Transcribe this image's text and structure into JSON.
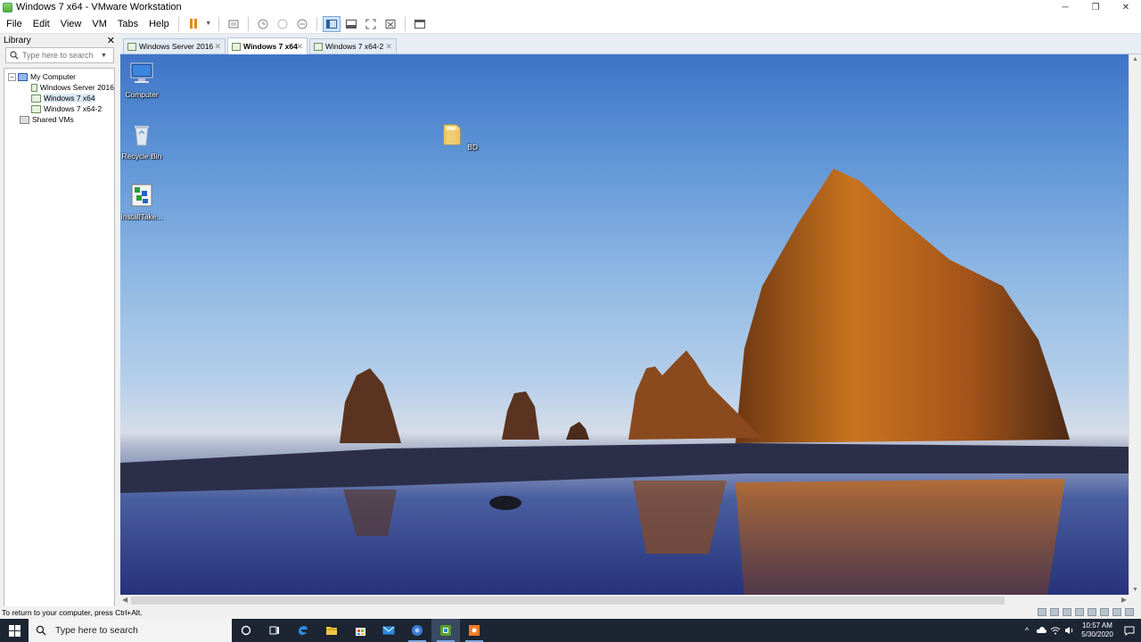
{
  "window": {
    "title": "Windows 7 x64 - VMware Workstation",
    "controls": {
      "minimize": "─",
      "restore": "❐",
      "close": "✕"
    }
  },
  "menu": {
    "items": [
      "File",
      "Edit",
      "View",
      "VM",
      "Tabs",
      "Help"
    ]
  },
  "toolbar": {
    "icons": [
      "pause-icon",
      "send-ctrl-alt-del-icon",
      "snapshot-icon",
      "revert-snapshot-icon",
      "snapshot-manager-icon",
      "show-library-icon",
      "thumbnail-bar-icon",
      "full-screen-icon",
      "unity-icon",
      "console-view-icon"
    ]
  },
  "library": {
    "title": "Library",
    "close": "✕",
    "search_placeholder": "Type here to search",
    "tree": {
      "root": "My Computer",
      "root_expander": "−",
      "vms": [
        "Windows Server 2016",
        "Windows 7 x64",
        "Windows 7 x64-2"
      ],
      "selected": "Windows 7 x64",
      "shared": "Shared VMs"
    }
  },
  "tabs": [
    {
      "label": "Windows Server 2016",
      "active": false
    },
    {
      "label": "Windows 7 x64",
      "active": true
    },
    {
      "label": "Windows 7 x64-2",
      "active": false
    }
  ],
  "tab_close": "✕",
  "guest": {
    "desktop_icons": [
      {
        "label": "Computer",
        "icon": "computer-icon"
      },
      {
        "label": "Recycle Bin",
        "icon": "recycle-bin-icon"
      },
      {
        "label": "InstallTake...",
        "icon": "installer-icon"
      },
      {
        "label": "BD",
        "icon": "folder-icon"
      }
    ],
    "wallpaper": "sea-stack-sunset"
  },
  "statusbar": {
    "message": "To return to your computer, press Ctrl+Alt."
  },
  "taskbar": {
    "search_placeholder": "Type here to search",
    "apps": [
      "task-view-icon",
      "edge-icon",
      "file-explorer-icon",
      "store-icon",
      "mail-icon",
      "browser-icon",
      "vmware-icon",
      "app-icon"
    ],
    "clock_time": "10:57 AM",
    "clock_date": "5/30/2020",
    "tray_expand": "^"
  },
  "colors": {
    "taskbar": "#1d2533",
    "accent": "#7aa7e0",
    "pause": "#e08a1a"
  }
}
